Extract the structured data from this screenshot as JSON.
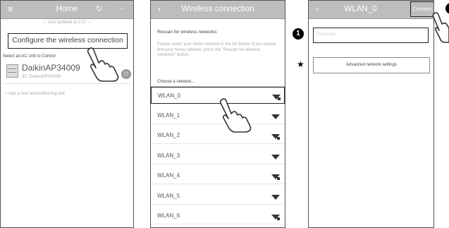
{
  "screen1": {
    "title": "Home",
    "menu_icon": "hamburger-icon",
    "refresh_icon": "refresh-icon",
    "more_icon": "ellipsis-icon",
    "last_updated": "— Last updated at 2:17 —",
    "configure_button": "Configure the wireless connection",
    "select_label": "Select an AC Unit to Control",
    "unit": {
      "name": "DaikinAP34009",
      "id": "ID: DaikinAP34009"
    },
    "add_unit": "+ Add a new airconditioning unit"
  },
  "screen2": {
    "title": "Wireless connection",
    "back_icon": "chevron-left-icon",
    "rescan_header": "Rescan for wireless networks",
    "description": "Please select your home network in the list below. If you cannot find your home network, press the \"Rescan for wireless networks\" button.",
    "choose_label": "Choose a network...",
    "networks": [
      {
        "name": "WLAN_0",
        "secure": true
      },
      {
        "name": "WLAN_1",
        "secure": false
      },
      {
        "name": "WLAN_2",
        "secure": true
      },
      {
        "name": "WLAN_3",
        "secure": false
      },
      {
        "name": "WLAN_4",
        "secure": true
      },
      {
        "name": "WLAN_5",
        "secure": false
      },
      {
        "name": "WLAN_6",
        "secure": true
      }
    ]
  },
  "screen3": {
    "title": "WLAN_0",
    "back_icon": "chevron-left-icon",
    "connect_button": "Connect",
    "password_placeholder": "Password",
    "advanced_button": "Advanced network settings"
  },
  "annotations": {
    "badge_1": "1",
    "star": "★"
  },
  "colors": {
    "bar": "#bdbdbd",
    "highlight_border": "#222222",
    "badge": "#000000"
  }
}
